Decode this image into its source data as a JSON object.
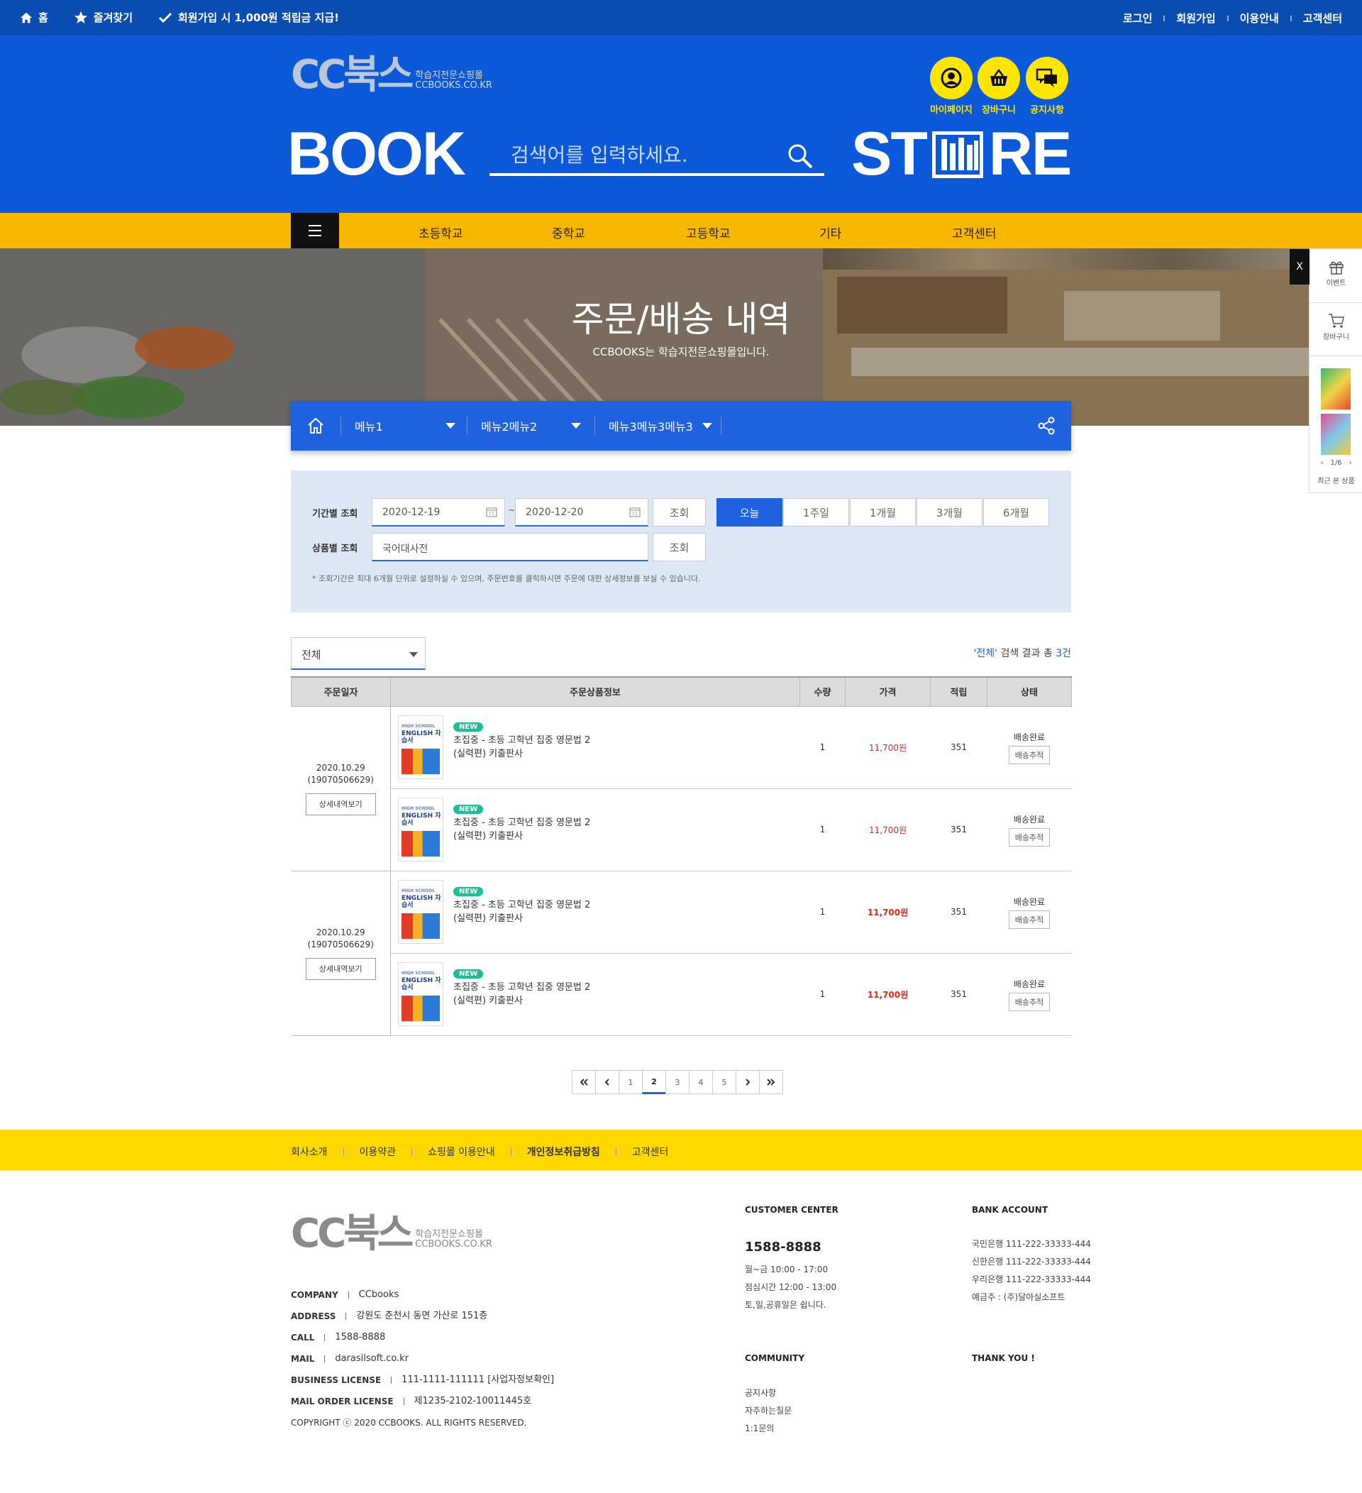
{
  "topbar": {
    "home": "홈",
    "bookmark": "즐겨찾기",
    "promo": "회원가입 시 1,000원 적립금 지급!",
    "links": [
      "로그인",
      "회원가입",
      "이용안내",
      "고객센터"
    ]
  },
  "header": {
    "logo_big": "CC북스",
    "logo_sub": "학습지전문쇼핑몰",
    "logo_url": "CCBOOKS.CO.KR",
    "book": "BOOK",
    "store_left": "ST",
    "store_right": "RE",
    "search_placeholder": "검색어를 입력하세요.",
    "icons": [
      {
        "label": "마이페이지",
        "icon": "user-icon"
      },
      {
        "label": "장바구니",
        "icon": "basket-icon"
      },
      {
        "label": "공지사항",
        "icon": "chat-icon"
      }
    ]
  },
  "nav": {
    "items": [
      "초등학교",
      "중학교",
      "고등학교",
      "기타",
      "고객센터"
    ]
  },
  "banner": {
    "title": "주문/배송 내역",
    "subtitle": "CCBOOKS는 학습지전문쇼핑몰입니다."
  },
  "breadcrumb": {
    "menus": [
      "메뉴1",
      "메뉴2메뉴2",
      "메뉴3메뉴3메뉴3"
    ]
  },
  "filter": {
    "period_label": "기간별 조회",
    "date_from": "2020-12-19",
    "date_sep": "~",
    "date_to": "2020-12-20",
    "search_btn": "조회",
    "ranges": [
      "오늘",
      "1주일",
      "1개월",
      "3개월",
      "6개월"
    ],
    "product_label": "상품별 조회",
    "product_value": "국어대사전",
    "note": "* 조회기간은 최대 6개월 단위로 설정하실 수 있으며, 주문번호를 클릭하시면 주문에 대한 상세정보를 보실 수 있습니다."
  },
  "list": {
    "select_value": "전체",
    "result_prefix": "'전체'",
    "result_mid": " 검색 결과 총 ",
    "result_count": "3건",
    "headers": [
      "주문일자",
      "주문상품정보",
      "수량",
      "가격",
      "적립",
      "상태"
    ],
    "detail_btn": "상세내역보기",
    "new_badge": "NEW",
    "thumb_school": "HIGH SCHOOL",
    "thumb_title": "ENGLISH 자습서",
    "orders": [
      {
        "date": "2020.10.29",
        "order_no": "(19070506629)",
        "items": [
          {
            "name1": "초집중 - 초등 고학년 집중 영문법 2",
            "name2": "(실력편) 키출판사",
            "qty": "1",
            "price": "11,700원",
            "point": "351",
            "status": "배송완료",
            "track": "배송추적"
          },
          {
            "name1": "초집중 - 초등 고학년 집중 영문법 2",
            "name2": "(실력편) 키출판사",
            "qty": "1",
            "price": "11,700원",
            "point": "351",
            "status": "배송완료",
            "track": "배송추적"
          }
        ]
      },
      {
        "date": "2020.10.29",
        "order_no": "(19070506629)",
        "items": [
          {
            "name1": "초집중 - 초등 고학년 집중 영문법 2",
            "name2": "(실력편) 키출판사",
            "qty": "1",
            "price": "11,700원",
            "point": "351",
            "status": "배송완료",
            "track": "배송추적"
          },
          {
            "name1": "초집중 - 초등 고학년 집중 영문법 2",
            "name2": "(실력편) 키출판사",
            "qty": "1",
            "price": "11,700원",
            "point": "351",
            "status": "배송완료",
            "track": "배송추적"
          }
        ]
      }
    ]
  },
  "pager": {
    "pages": [
      "1",
      "2",
      "3",
      "4",
      "5"
    ],
    "current": "2"
  },
  "footer_links": [
    "회사소개",
    "이용약관",
    "쇼핑몰 이용안내",
    "개인정보취급방침",
    "고객센터"
  ],
  "footer": {
    "company_k": "COMPANY",
    "company_v": "CCbooks",
    "address_k": "ADDRESS",
    "address_v": "강원도 춘천시 동면 가산로 151층",
    "call_k": "CALL",
    "call_v": "1588-8888",
    "mail_k": "MAIL",
    "mail_v": "darasilsoft.co.kr",
    "biz_k": "BUSINESS LICENSE",
    "biz_v": "111-1111-111111 [사업자정보확인]",
    "order_k": "MAIL ORDER LICENSE",
    "order_v": "제1235-2102-10011445호",
    "copyright": "COPYRIGHT ⓒ 2020 CCBOOKS. ALL RIGHTS RESERVED.",
    "cc_head": "CUSTOMER CENTER",
    "cc_phone": "1588-8888",
    "cc_hours": "월~금 10:00 - 17:00",
    "cc_lunch": "점심시간 12:00 - 13:00",
    "cc_off": "토,일,공휴일은 쉽니다.",
    "bank_head": "BANK ACCOUNT",
    "banks": [
      "국민은행 111-222-33333-444",
      "신한은행 111-222-33333-444",
      "우리은행 111-222-33333-444",
      "예금주 : (주)달아실소프트"
    ],
    "community_head": "COMMUNITY",
    "community": [
      "공지사항",
      "자주하는질문",
      "1:1문의"
    ],
    "thanks": "THANK YOU !"
  },
  "quick": {
    "close": "X",
    "event": "이벤트",
    "cart": "장바구니",
    "page": "1/6",
    "recent": "최근 본 상품"
  },
  "colors": {
    "primary": "#0b59d8",
    "topbar": "#0a4db0",
    "nav": "#f7b600",
    "footbar": "#ffd800",
    "price": "#e1261c",
    "new": "#1fbf95"
  }
}
